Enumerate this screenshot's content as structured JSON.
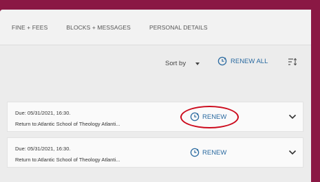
{
  "tabs": [
    "FINE + FEES",
    "BLOCKS + MESSAGES",
    "PERSONAL DETAILS"
  ],
  "toolbar": {
    "sort_label": "Sort by",
    "renew_all_label": "RENEW ALL"
  },
  "items": [
    {
      "due": "Due: 05/31/2021, 16:30.",
      "return_to": "Return to:Atlantic School of Theology Atlanti...",
      "renew_label": "RENEW"
    },
    {
      "due": "Due: 05/31/2021, 16:30.",
      "return_to": "Return to:Atlantic School of Theology Atlanti...",
      "renew_label": "RENEW"
    }
  ],
  "colors": {
    "frame": "#8a1844",
    "link": "#2a6aa0",
    "highlight_circle": "#cc0a1c"
  },
  "icons": [
    "renew-clock-icon",
    "dropdown-caret-icon",
    "sort-order-icon",
    "chevron-down-icon"
  ]
}
